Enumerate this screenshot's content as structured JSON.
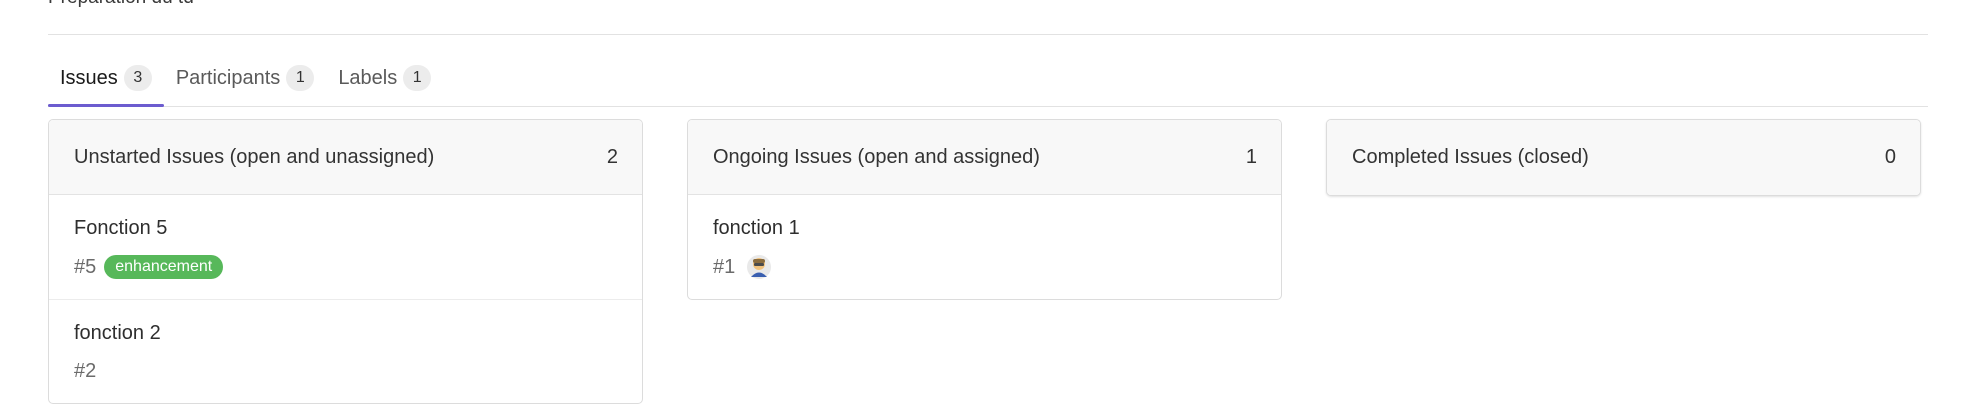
{
  "header": {
    "title": "Préparation du td"
  },
  "tabs": [
    {
      "label": "Issues",
      "count": "3",
      "active": true
    },
    {
      "label": "Participants",
      "count": "1",
      "active": false
    },
    {
      "label": "Labels",
      "count": "1",
      "active": false
    }
  ],
  "columns": {
    "unstarted": {
      "title": "Unstarted Issues (open and unassigned)",
      "count": "2",
      "issues": [
        {
          "title": "Fonction 5",
          "number": "#5",
          "label": "enhancement",
          "label_color": "#57b85a"
        },
        {
          "title": "fonction 2",
          "number": "#2"
        }
      ]
    },
    "ongoing": {
      "title": "Ongoing Issues (open and assigned)",
      "count": "1",
      "issues": [
        {
          "title": "fonction 1",
          "number": "#1",
          "assignee_icon": "user-avatar-icon"
        }
      ]
    },
    "completed": {
      "title": "Completed Issues (closed)",
      "count": "0",
      "issues": []
    }
  },
  "colors": {
    "accent": "#6c5ccf",
    "enhancement": "#57b85a"
  }
}
